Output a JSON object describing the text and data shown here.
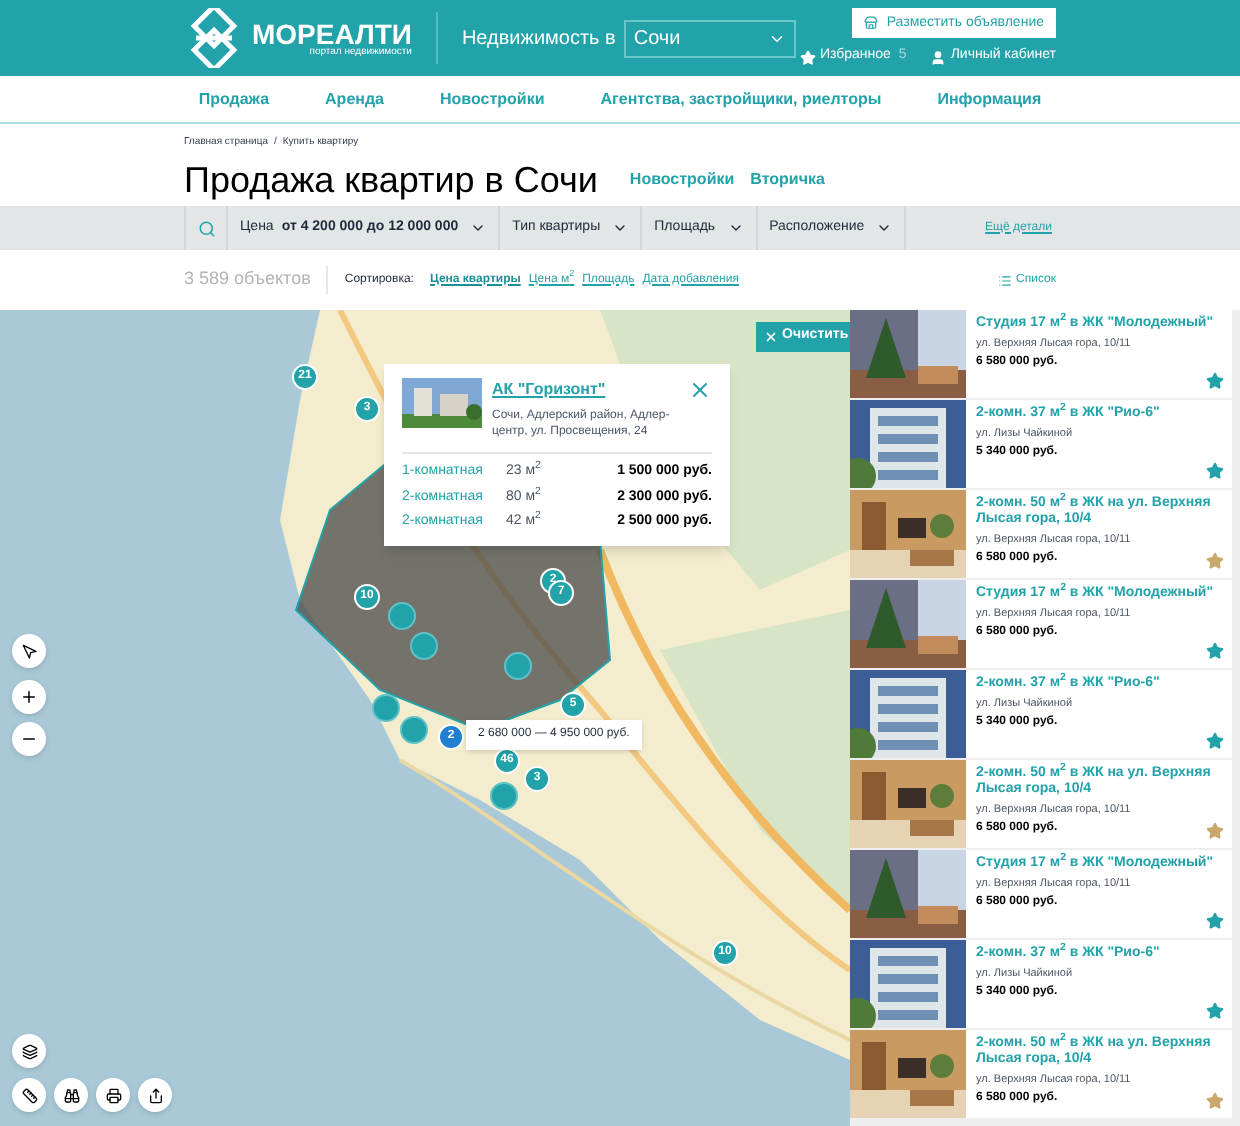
{
  "header": {
    "logo": "МОРЕАЛТИ",
    "tagline": "портал недвижимости",
    "city_label": "Недвижимость в",
    "city": "Сочи",
    "post_button": "Разместить объявление",
    "favorites": "Избранное",
    "favorites_count": "5",
    "account": "Личный кабинет"
  },
  "nav": [
    "Продажа",
    "Аренда",
    "Новостройки",
    "Агентства, застройщики, риелторы",
    "Информация"
  ],
  "breadcrumbs": [
    "Главная страница",
    "/",
    "Купить квартиру"
  ],
  "title": "Продажа квартир в Сочи",
  "title_links": [
    "Новостройки",
    "Вторичка"
  ],
  "filters": [
    {
      "label": "Цена",
      "value": "от 4 200 000 до 12 000 000"
    },
    {
      "label": "Тип квартиры"
    },
    {
      "label": "Площадь"
    },
    {
      "label": "Расположение"
    }
  ],
  "more_filters": "Ещё детали",
  "count": "3 589 объектов",
  "sort_label": "Сортировка:",
  "sort_options": [
    {
      "label": "Цена квартиры",
      "selected": true
    },
    {
      "label": "Цена м$^{2}$",
      "selected": false
    },
    {
      "label": "Площадь",
      "selected": false
    },
    {
      "label": "Дата добавления",
      "selected": false
    }
  ],
  "view_toggle": "Список",
  "map": {
    "clear_button": "Очистить",
    "markers": [
      {
        "label": "21",
        "selected": false
      },
      {
        "label": "3",
        "selected": false
      },
      {
        "label": "10",
        "selected": false
      },
      {
        "label": "2",
        "selected": false
      },
      {
        "label": "7",
        "selected": false
      },
      {
        "label": "5",
        "selected": false
      },
      {
        "label": "2",
        "selected": true
      },
      {
        "label": "46",
        "selected": false
      },
      {
        "label": "3",
        "selected": false
      },
      {
        "label": "10",
        "selected": false
      }
    ],
    "tooltip": "2 680 000 — 4 950 000 руб.",
    "popup": {
      "title": "АК \"Горизонт\"",
      "address": "Сочи, Адлерский район, Адлер-центр, ул. Просвещения, 24",
      "rows": [
        {
          "type": "1-комнатная",
          "area": "23 м$^{2}$",
          "price": "1 500 000 руб."
        },
        {
          "type": "2-комнатная",
          "area": "80 м$^{2}$",
          "price": "2 300 000 руб."
        },
        {
          "type": "2-комнатная",
          "area": "42 м$^{2}$",
          "price": "2 500 000 руб."
        }
      ]
    }
  },
  "listings": [
    {
      "title": "Студия 17 м$^{2}$ в ЖК \"Молодежный\"",
      "address": "ул. Верхняя Лысая гора, 10/11",
      "price": "6 580 000 руб.",
      "starred": false
    },
    {
      "title": "2-комн. 37 м$^{2}$ в ЖК \"Рио-6\"",
      "address": "ул. Лизы Чайкиной",
      "price": "5 340 000 руб.",
      "starred": false
    },
    {
      "title": "2-комн. 50 м$^{2}$ в ЖК на ул. Верхняя Лысая гора, 10/4",
      "address": "ул. Верхняя Лысая гора, 10/11",
      "price": "6 580 000 руб.",
      "starred": true
    },
    {
      "title": "Студия 17 м$^{2}$ в ЖК \"Молодежный\"",
      "address": "ул. Верхняя Лысая гора, 10/11",
      "price": "6 580 000 руб.",
      "starred": false
    },
    {
      "title": "2-комн. 37 м$^{2}$ в ЖК \"Рио-6\"",
      "address": "ул. Лизы Чайкиной",
      "price": "5 340 000 руб.",
      "starred": false
    },
    {
      "title": "2-комн. 50 м$^{2}$ в ЖК на ул. Верхняя Лысая гора, 10/4",
      "address": "ул. Верхняя Лысая гора, 10/11",
      "price": "6 580 000 руб.",
      "starred": true
    },
    {
      "title": "Студия 17 м$^{2}$ в ЖК \"Молодежный\"",
      "address": "ул. Верхняя Лысая гора, 10/11",
      "price": "6 580 000 руб.",
      "starred": false
    },
    {
      "title": "2-комн. 37 м$^{2}$ в ЖК \"Рио-6\"",
      "address": "ул. Лизы Чайкиной",
      "price": "5 340 000 руб.",
      "starred": false
    },
    {
      "title": "2-комн. 50 м$^{2}$ в ЖК на ул. Верхняя Лысая гора, 10/4",
      "address": "ул. Верхняя Лысая гора, 10/11",
      "price": "6 580 000 руб.",
      "starred": true
    }
  ]
}
